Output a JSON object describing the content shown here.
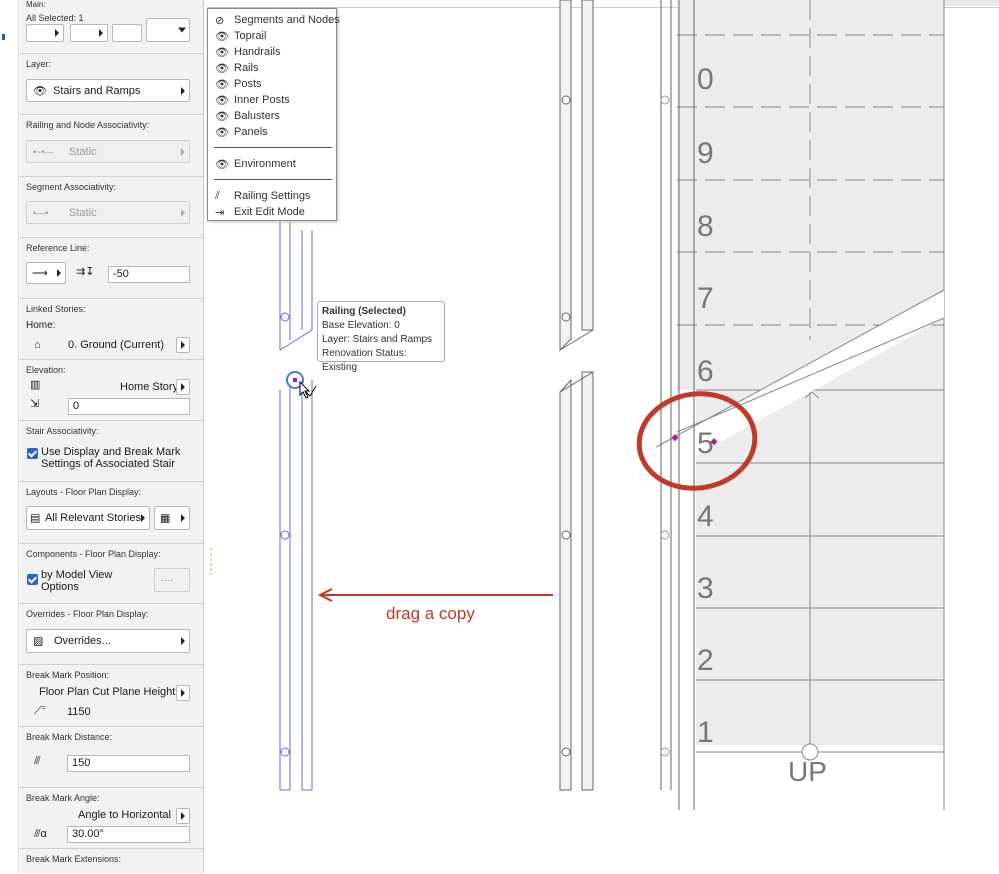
{
  "panel": {
    "main": {
      "label": "Main:",
      "selected": "All Selected: 1"
    },
    "layer": {
      "label": "Layer:",
      "value": "Stairs and Ramps"
    },
    "railing_assoc": {
      "label": "Railing and Node Associativity:",
      "value": "Static"
    },
    "segment_assoc": {
      "label": "Segment Associativity:",
      "value": "Static"
    },
    "reference_line": {
      "label": "Reference Line:",
      "offset": "-50"
    },
    "linked_stories": {
      "label": "Linked Stories:",
      "home_label": "Home:",
      "home_value": "0. Ground (Current)"
    },
    "elevation": {
      "label": "Elevation:",
      "ref": "Home Story",
      "value": "0"
    },
    "stair_assoc": {
      "label": "Stair Associativity:",
      "checkbox": "Use Display and Break Mark Settings of Associated Stair"
    },
    "layouts": {
      "label": "Layouts - Floor Plan Display:",
      "value": "All Relevant Stories"
    },
    "components": {
      "label": "Components - Floor Plan Display:",
      "checkbox": "by Model View Options"
    },
    "overrides": {
      "label": "Overrides - Floor Plan Display:",
      "value": "Overrides..."
    },
    "break_position": {
      "label": "Break Mark Position:",
      "ref": "Floor Plan Cut Plane Height",
      "value": "1150"
    },
    "break_distance": {
      "label": "Break Mark Distance:",
      "value": "150"
    },
    "break_angle": {
      "label": "Break Mark Angle:",
      "ref": "Angle to Horizontal",
      "value": "30.00°"
    },
    "break_extensions": {
      "label": "Break Mark Extensions:"
    }
  },
  "menu": {
    "items": [
      "Segments and Nodes",
      "Toprail",
      "Handrails",
      "Rails",
      "Posts",
      "Inner Posts",
      "Balusters",
      "Panels"
    ],
    "environment": "Environment",
    "railing_settings": "Railing Settings",
    "exit_edit": "Exit Edit Mode"
  },
  "tooltip": {
    "title": "Railing (Selected)",
    "base_elevation": "Base Elevation: 0",
    "layer": "Layer: Stairs and Ramps",
    "renovation": "Renovation Status: Existing"
  },
  "annotation": {
    "drag_label": "drag a copy",
    "color": "#c0392b"
  },
  "stair": {
    "step_numbers": [
      "0",
      "9",
      "8",
      "7",
      "6",
      "5",
      "4",
      "3",
      "2",
      "1"
    ],
    "up_label": "UP"
  },
  "colors": {
    "selection": "#6a6ad8",
    "accent": "#2f62c9",
    "annotation": "#c0392b"
  }
}
